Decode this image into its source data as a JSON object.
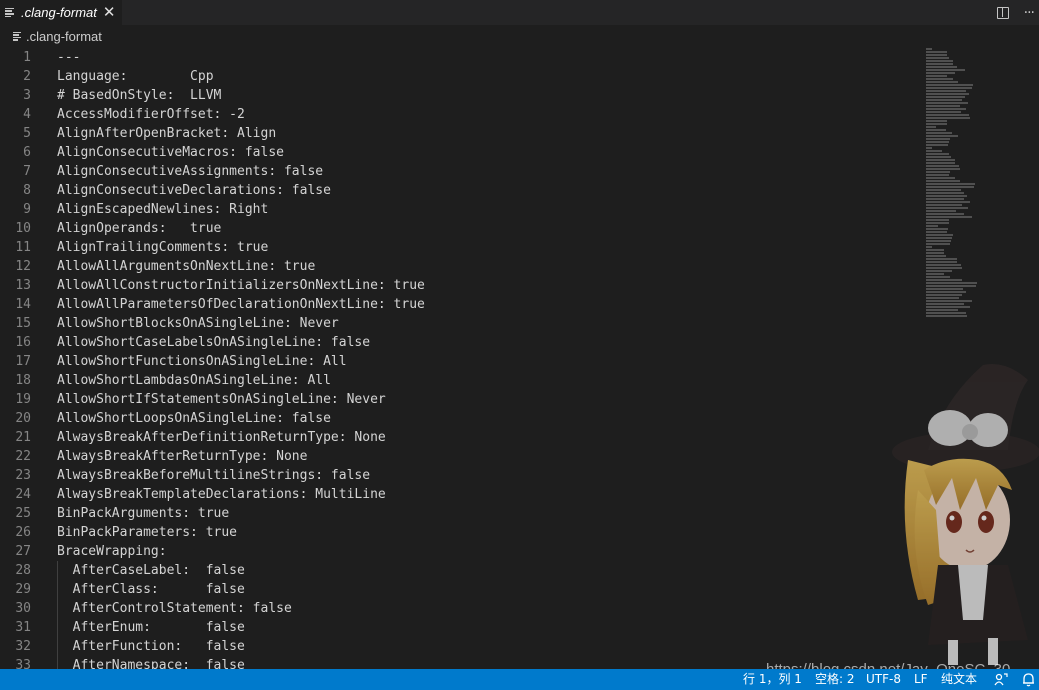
{
  "tab": {
    "title": ".clang-format",
    "close_glyph": "✕",
    "icon": "lines-icon"
  },
  "editor_actions": {
    "split_icon": "split-editor-icon",
    "more_glyph": "···"
  },
  "breadcrumb": {
    "label": ".clang-format",
    "icon": "lines-icon"
  },
  "code_lines": [
    {
      "n": "1",
      "text": "---"
    },
    {
      "n": "2",
      "text": "Language:        Cpp"
    },
    {
      "n": "3",
      "text": "# BasedOnStyle:  LLVM"
    },
    {
      "n": "4",
      "text": "AccessModifierOffset: -2"
    },
    {
      "n": "5",
      "text": "AlignAfterOpenBracket: Align"
    },
    {
      "n": "6",
      "text": "AlignConsecutiveMacros: false"
    },
    {
      "n": "7",
      "text": "AlignConsecutiveAssignments: false"
    },
    {
      "n": "8",
      "text": "AlignConsecutiveDeclarations: false"
    },
    {
      "n": "9",
      "text": "AlignEscapedNewlines: Right"
    },
    {
      "n": "10",
      "text": "AlignOperands:   true"
    },
    {
      "n": "11",
      "text": "AlignTrailingComments: true"
    },
    {
      "n": "12",
      "text": "AllowAllArgumentsOnNextLine: true"
    },
    {
      "n": "13",
      "text": "AllowAllConstructorInitializersOnNextLine: true"
    },
    {
      "n": "14",
      "text": "AllowAllParametersOfDeclarationOnNextLine: true"
    },
    {
      "n": "15",
      "text": "AllowShortBlocksOnASingleLine: Never"
    },
    {
      "n": "16",
      "text": "AllowShortCaseLabelsOnASingleLine: false"
    },
    {
      "n": "17",
      "text": "AllowShortFunctionsOnASingleLine: All"
    },
    {
      "n": "18",
      "text": "AllowShortLambdasOnASingleLine: All"
    },
    {
      "n": "19",
      "text": "AllowShortIfStatementsOnASingleLine: Never"
    },
    {
      "n": "20",
      "text": "AllowShortLoopsOnASingleLine: false"
    },
    {
      "n": "21",
      "text": "AlwaysBreakAfterDefinitionReturnType: None"
    },
    {
      "n": "22",
      "text": "AlwaysBreakAfterReturnType: None"
    },
    {
      "n": "23",
      "text": "AlwaysBreakBeforeMultilineStrings: false"
    },
    {
      "n": "24",
      "text": "AlwaysBreakTemplateDeclarations: MultiLine"
    },
    {
      "n": "25",
      "text": "BinPackArguments: true"
    },
    {
      "n": "26",
      "text": "BinPackParameters: true"
    },
    {
      "n": "27",
      "text": "BraceWrapping:"
    },
    {
      "n": "28",
      "text": "  AfterCaseLabel:  false"
    },
    {
      "n": "29",
      "text": "  AfterClass:      false"
    },
    {
      "n": "30",
      "text": "  AfterControlStatement: false"
    },
    {
      "n": "31",
      "text": "  AfterEnum:       false"
    },
    {
      "n": "32",
      "text": "  AfterFunction:   false"
    },
    {
      "n": "33",
      "text": "  AfterNamespace:  false"
    }
  ],
  "watermark": "https://blog.csdn.net/Jay_OneSC_30",
  "status_bar": {
    "position": "行 1，列 1",
    "indent": "空格: 2",
    "encoding": "UTF-8",
    "eol": "LF",
    "language": "纯文本",
    "feedback_icon": "person-feedback-icon",
    "bell_icon": "bell-icon"
  },
  "colors": {
    "editor_bg": "#1e1e1e",
    "tabbar_bg": "#252526",
    "status_bar_bg": "#007acc",
    "text": "#d4d4d4",
    "line_number": "#858585"
  }
}
